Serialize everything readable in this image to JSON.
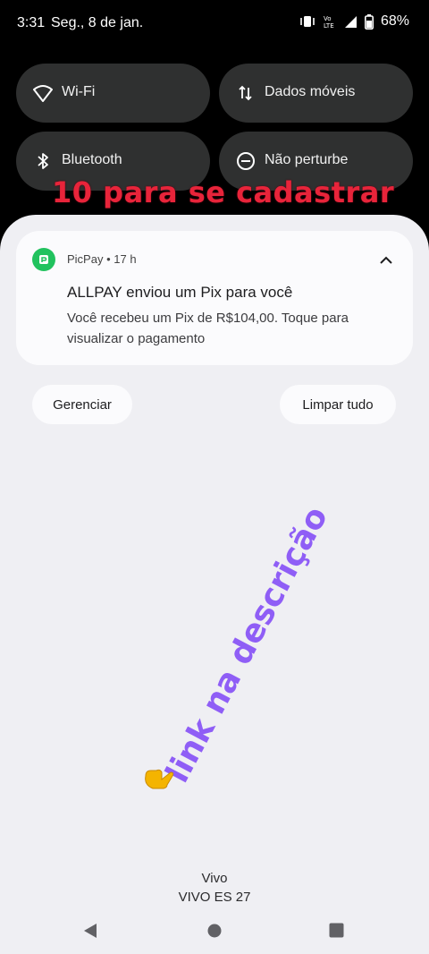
{
  "status_bar": {
    "time": "3:31",
    "date": "Seg., 8 de jan.",
    "battery": "68%",
    "network_label": "LTE"
  },
  "quick_settings": [
    {
      "label": "Wi-Fi",
      "icon": "wifi-icon"
    },
    {
      "label": "Dados móveis",
      "icon": "mobile-data-icon"
    },
    {
      "label": "Bluetooth",
      "icon": "bluetooth-icon"
    },
    {
      "label": "Não perturbe",
      "icon": "do-not-disturb-icon"
    }
  ],
  "overlay_text_red": "10 para se cadastrar",
  "notification": {
    "app": "PicPay",
    "time": "17 h",
    "title": "ALLPAY enviou um Pix para você",
    "body": "Você recebeu um Pix de R$104,00. Toque para visualizar o pagamento"
  },
  "actions": {
    "manage": "Gerenciar",
    "clear_all": "Limpar tudo"
  },
  "overlay_text_purple": "link na descrição",
  "carrier": {
    "line1": "Vivo",
    "line2": "VIVO ES 27"
  },
  "colors": {
    "tile_bg": "#2f3030",
    "shade_bg": "#efeff3",
    "picpay_green": "#21c25e",
    "overlay_red": "#e8243a",
    "overlay_purple": "#8f5ef6"
  }
}
